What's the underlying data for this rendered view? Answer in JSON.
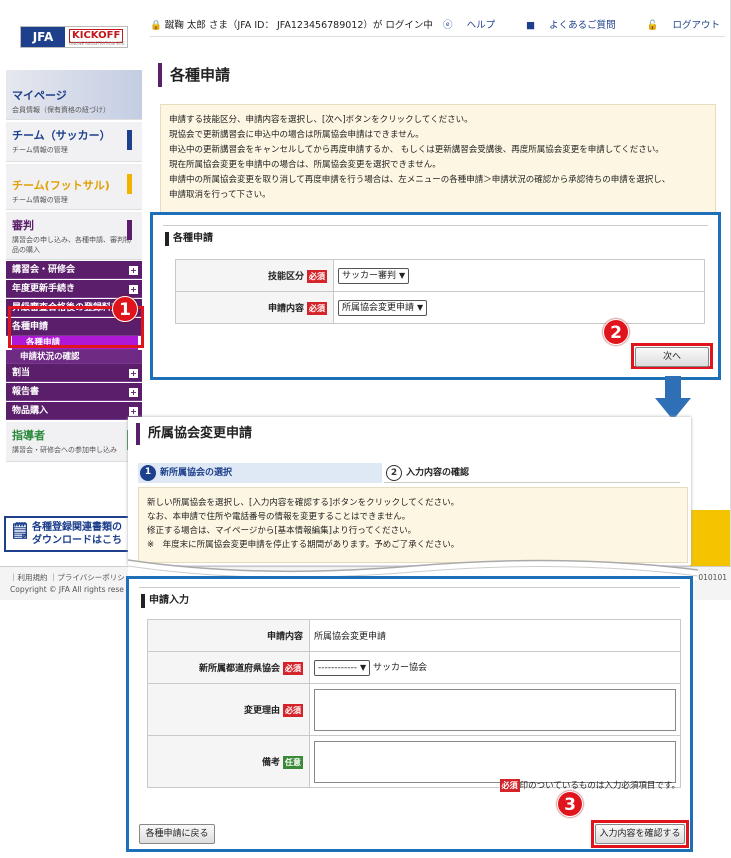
{
  "header": {
    "logo_text": "JFA",
    "logo_brand": "KICKOFF",
    "logo_sub": "ONLINE REGISTRATION SITE",
    "login_text": "蹴鞠 太郎 さま（JFA ID： JFA123456789012）が ログイン中",
    "help": "ヘルプ",
    "faq": "よくあるご質問",
    "logout": "ログアウト"
  },
  "sidebar": {
    "mypage_title": "マイページ",
    "mypage_sub": "会員情報（保有資格の紐づけ）",
    "soccer_title": "チーム（サッカー）",
    "soccer_sub": "チーム情報の管理",
    "futsal_title": "チーム(フットサル)",
    "futsal_sub": "チーム情報の管理",
    "referee_title": "審判",
    "referee_sub": "講習会の申し込み、各種申請、審判物品の購入",
    "items": [
      "講習会・研修会",
      "年度更新手続き",
      "昇級審査合格後の登録料支払",
      "各種申請",
      "各種申請",
      "申請状況の確認",
      "割当",
      "報告書",
      "物品購入"
    ],
    "coach_title": "指導者",
    "coach_sub": "講習会・研修会への参加申し込み",
    "banner_line1": "各種登録関連書類の",
    "banner_line2": "ダウンロードはこち"
  },
  "footer": {
    "links": "｜利用規約 ｜プライバシーポリシ",
    "copyright": "Copyright © JFA All rights rese",
    "code": "010101"
  },
  "main": {
    "title": "各種申請",
    "notice": [
      "申請する技能区分、申請内容を選択し、[次へ]ボタンをクリックしてください。",
      "現協会で更新講習会に申込中の場合は所属協会申請はできません。",
      "申込中の更新講習会をキャンセルしてから再度申請するか、 もしくは更新講習会受講後、再度所属協会変更を申請してください。",
      "現在所属協会変更を申請中の場合は、所属協会変更を選択できません。",
      "申請中の所属協会変更を取り消して再度申請を行う場合は、左メニューの各種申請＞申請状況の確認から承認待ちの申請を選択し、",
      "申請取消を行って下さい。"
    ],
    "section_title": "各種申請",
    "field1_label": "技能区分",
    "field1_value": "サッカー審判",
    "field2_label": "申請内容",
    "field2_value": "所属協会変更申請",
    "required": "必須",
    "next_button": "次へ"
  },
  "page2": {
    "title": "所属協会変更申請",
    "step1_num": "1",
    "step1_label": "新所属協会の選択",
    "step2_num": "2",
    "step2_label": "入力内容の確認",
    "notice": [
      "新しい所属協会を選択し、[入力内容を確認する]ボタンをクリックしてください。",
      "なお、本申請で住所や電話番号の情報を変更することはできません。",
      "修正する場合は、マイページから[基本情報編集]より行ってください。",
      "※　年度末に所属協会変更申請を停止する期間があります。予めご了承ください。"
    ]
  },
  "form": {
    "section_title": "申請入力",
    "content_label": "申請内容",
    "content_value": "所属協会変更申請",
    "pref_label": "新所属都道府県協会",
    "pref_value": "------------",
    "pref_suffix": "サッカー協会",
    "reason_label": "変更理由",
    "note_label": "備考",
    "required": "必須",
    "optional": "任意",
    "required_note_badge": "必須",
    "required_note": "印のついているものは入力必須項目です。",
    "back_button": "各種申請に戻る",
    "confirm_button": "入力内容を確認する"
  },
  "annotations": {
    "badge1": "1",
    "badge2": "2",
    "badge3": "3"
  },
  "colors": {
    "frame_blue": "#1d6fb8",
    "highlight_red": "#e0141c",
    "menu_purple": "#5a1e6b",
    "brand_navy": "#1d3f8c"
  }
}
